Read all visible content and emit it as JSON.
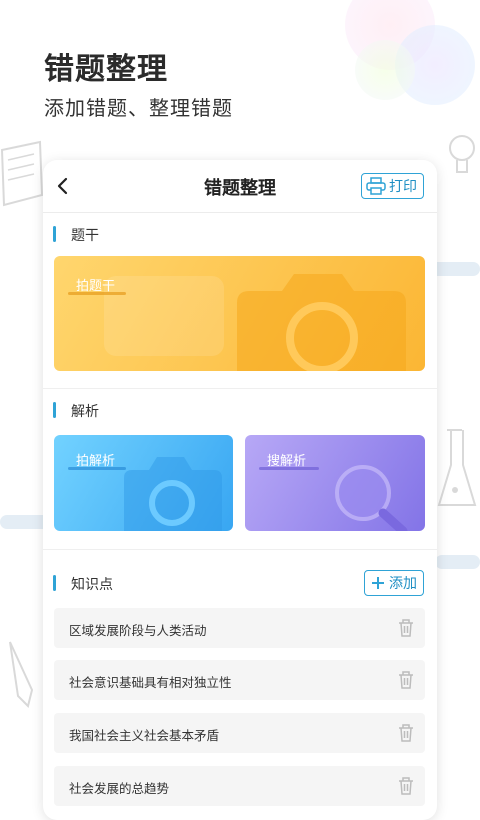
{
  "hero": {
    "title": "错题整理",
    "subtitle": "添加错题、整理错题"
  },
  "nav": {
    "title": "错题整理",
    "print_label": "打印"
  },
  "sections": {
    "stem": {
      "label": "题干",
      "photo_label": "拍题干"
    },
    "analysis": {
      "label": "解析",
      "photo_label": "拍解析",
      "search_label": "搜解析"
    },
    "knowledge": {
      "label": "知识点",
      "add_label": "添加"
    }
  },
  "knowledge_points": [
    "区域发展阶段与人类活动",
    "社会意识基础具有相对独立性",
    "我国社会主义社会基本矛盾",
    "社会发展的总趋势"
  ],
  "colors": {
    "accent": "#2fa3d6",
    "stem_gradient": [
      "#ffd46a",
      "#fbb734"
    ],
    "analysis_gradient": [
      "#6fd0ff",
      "#3ba9f3"
    ],
    "search_gradient": [
      "#b5a6f5",
      "#8576e8"
    ]
  }
}
